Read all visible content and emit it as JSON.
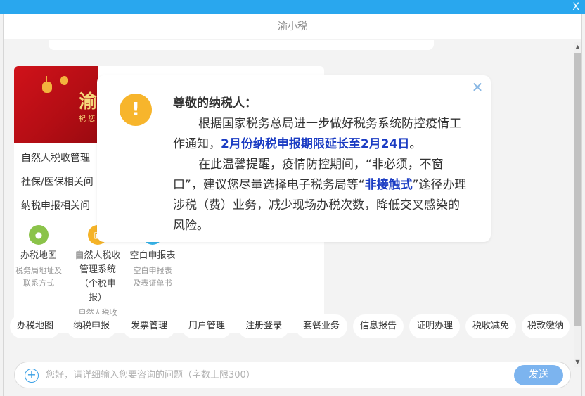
{
  "window": {
    "close_label": "X",
    "app_title": "渝小税"
  },
  "banner": {
    "text": "渝",
    "sub": "祝 您"
  },
  "menu_links": [
    "自然人税收管理",
    "社保/医保相关问",
    "纳税申报相关问"
  ],
  "services": [
    {
      "icon": "water-drop-icon",
      "color": "#8bc34a",
      "glyph": "●",
      "title": "办税地图",
      "desc": "税务局地址及联系方式"
    },
    {
      "icon": "document-icon",
      "color": "#f5b327",
      "glyph": "▣",
      "title": "自然人税收管理系统（个税申报）",
      "desc": "自然人税收"
    },
    {
      "icon": "form-icon",
      "color": "#37b3e8",
      "glyph": "▤",
      "title": "空白申报表",
      "desc": "空白申报表及表证单书"
    }
  ],
  "notice": {
    "greeting": "尊敬的纳税人：",
    "p1_a": "根据国家税务总局进一步做好税务系统防控疫情工作通知，",
    "p1_highlight": "2月份纳税申报期限延长至2月24日",
    "p1_b": "。",
    "p2_a": "在此温馨提醒，疫情防控期间，“非必须，不窗口”，建议您尽量选择电子税务局等“",
    "p2_highlight": "非接触式",
    "p2_b": "”途径办理涉税（费）业务，减少现场办税次数，降低交叉感染的风险。",
    "close_glyph": "✕",
    "warn_glyph": "!"
  },
  "quick_chips": [
    "办税地图",
    "纳税申报",
    "发票管理",
    "用户管理",
    "注册登录",
    "套餐业务",
    "信息报告",
    "证明办理",
    "税收减免",
    "税款缴纳"
  ],
  "input": {
    "placeholder": "您好，请详细输入您要咨询的问题（字数上限300）",
    "value": "",
    "send_label": "发送",
    "plus_glyph": "+"
  },
  "colors": {
    "titlebar": "#29a7ee",
    "highlight": "#1b3cc3",
    "warning": "#f7b52c",
    "send": "#7cb4ef"
  }
}
